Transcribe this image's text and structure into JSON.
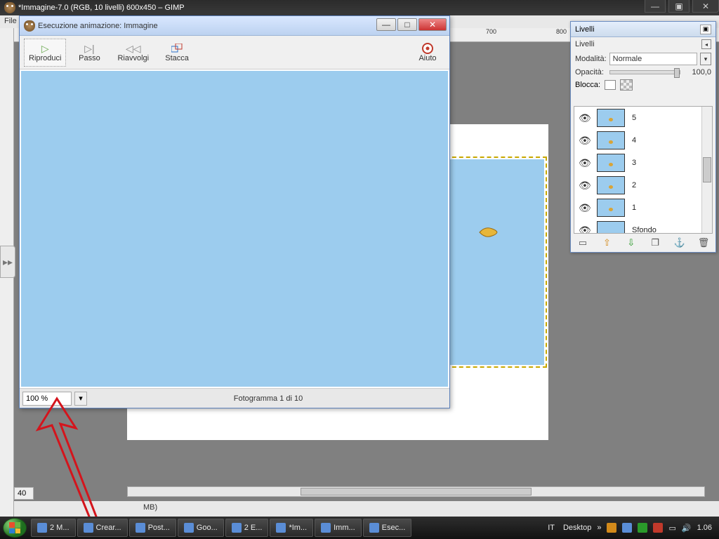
{
  "main_window": {
    "title": "*Immagine-7.0 (RGB, 10 livelli) 600x450 – GIMP",
    "menu_hint": "File"
  },
  "ruler": {
    "top_ticks": [
      "700",
      "800"
    ],
    "coord": "40",
    "status_suffix": "MB)"
  },
  "anim_dialog": {
    "title": "Esecuzione animazione: Immagine",
    "buttons": {
      "play": "Riproduci",
      "step": "Passo",
      "rewind": "Riavvolgi",
      "detach": "Stacca",
      "help": "Aiuto"
    },
    "zoom": "100 %",
    "frame_label": "Fotogramma 1 di 10"
  },
  "layers_panel": {
    "title": "Livelli",
    "section": "Livelli",
    "mode_label": "Modalità:",
    "mode_value": "Normale",
    "opacity_label": "Opacità:",
    "opacity_value": "100,0",
    "lock_label": "Blocca:",
    "layers": [
      {
        "name": "5",
        "fish": true
      },
      {
        "name": "4",
        "fish": true
      },
      {
        "name": "3",
        "fish": true
      },
      {
        "name": "2",
        "fish": true
      },
      {
        "name": "1",
        "fish": true
      },
      {
        "name": "Sfondo",
        "fish": false
      }
    ]
  },
  "taskbar": {
    "items": [
      "2 M...",
      "Crear...",
      "Post...",
      "Goo...",
      "2 E...",
      "*Im...",
      "Imm...",
      "Esec..."
    ],
    "lang": "IT",
    "desktop": "Desktop",
    "clock": "1.06"
  }
}
